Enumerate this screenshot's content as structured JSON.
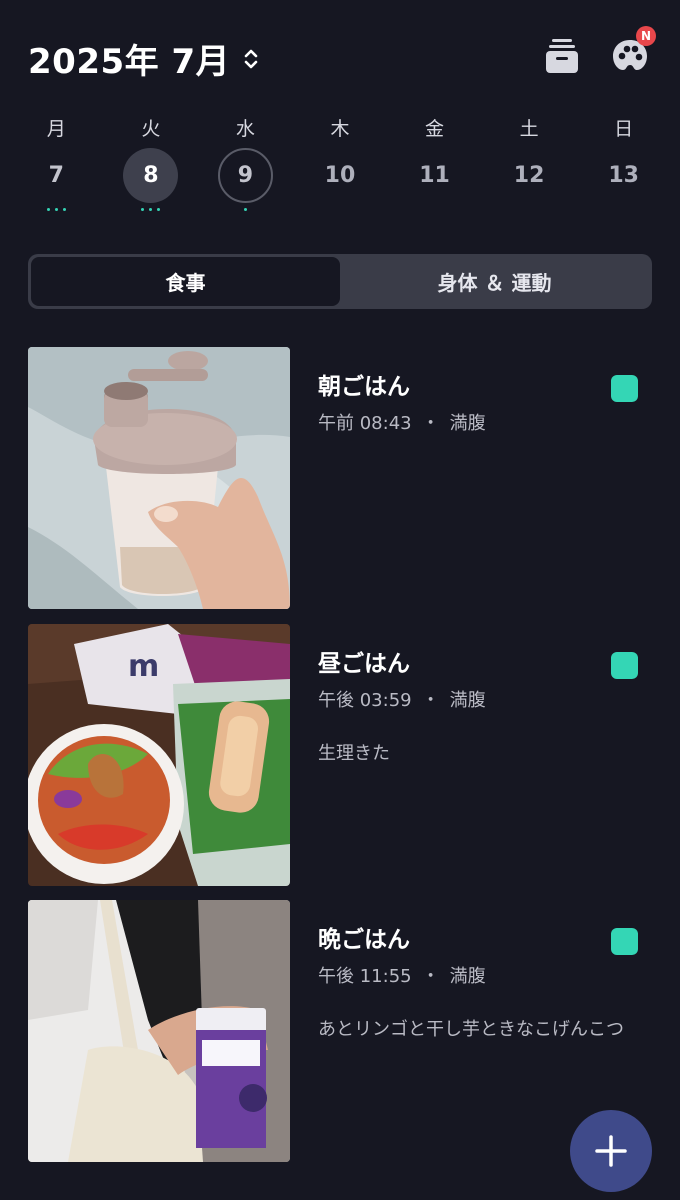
{
  "header": {
    "month_title": "2025年 7月",
    "archive_icon": "archive-box-icon",
    "palette_icon": "palette-icon",
    "badge_text": "N",
    "badge_color": "#e8474b"
  },
  "week": {
    "days": [
      {
        "dow": "月",
        "num": "7",
        "dots": 3
      },
      {
        "dow": "火",
        "num": "8",
        "dots": 3,
        "selected": true
      },
      {
        "dow": "水",
        "num": "9",
        "dots": 1,
        "today": true
      },
      {
        "dow": "木",
        "num": "10",
        "dots": 0
      },
      {
        "dow": "金",
        "num": "11",
        "dots": 0
      },
      {
        "dow": "土",
        "num": "12",
        "dots": 0
      },
      {
        "dow": "日",
        "num": "13",
        "dots": 0
      }
    ],
    "dot_color": "#34d3b4"
  },
  "tabs": [
    {
      "label": "食事",
      "active": true
    },
    {
      "label": "身体 ＆ 運動",
      "active": false
    }
  ],
  "meals": [
    {
      "title": "朝ごはん",
      "time": "午前 08:43",
      "fullness": "満腹",
      "note": "",
      "photo": "protein-shake-photo"
    },
    {
      "title": "昼ごはん",
      "time": "午後 03:59",
      "fullness": "満腹",
      "note": "生理きた",
      "photo": "salad-chicken-photo"
    },
    {
      "title": "晩ごはん",
      "time": "午後 11:55",
      "fullness": "満腹",
      "note": "あとリンゴと干し芋ときなこげんこつ",
      "photo": "yogurt-drink-photo"
    }
  ],
  "meta_separator": "・",
  "tag_color": "#34d6b5",
  "fab": {
    "icon": "plus-icon",
    "color": "#3f4a8a"
  }
}
